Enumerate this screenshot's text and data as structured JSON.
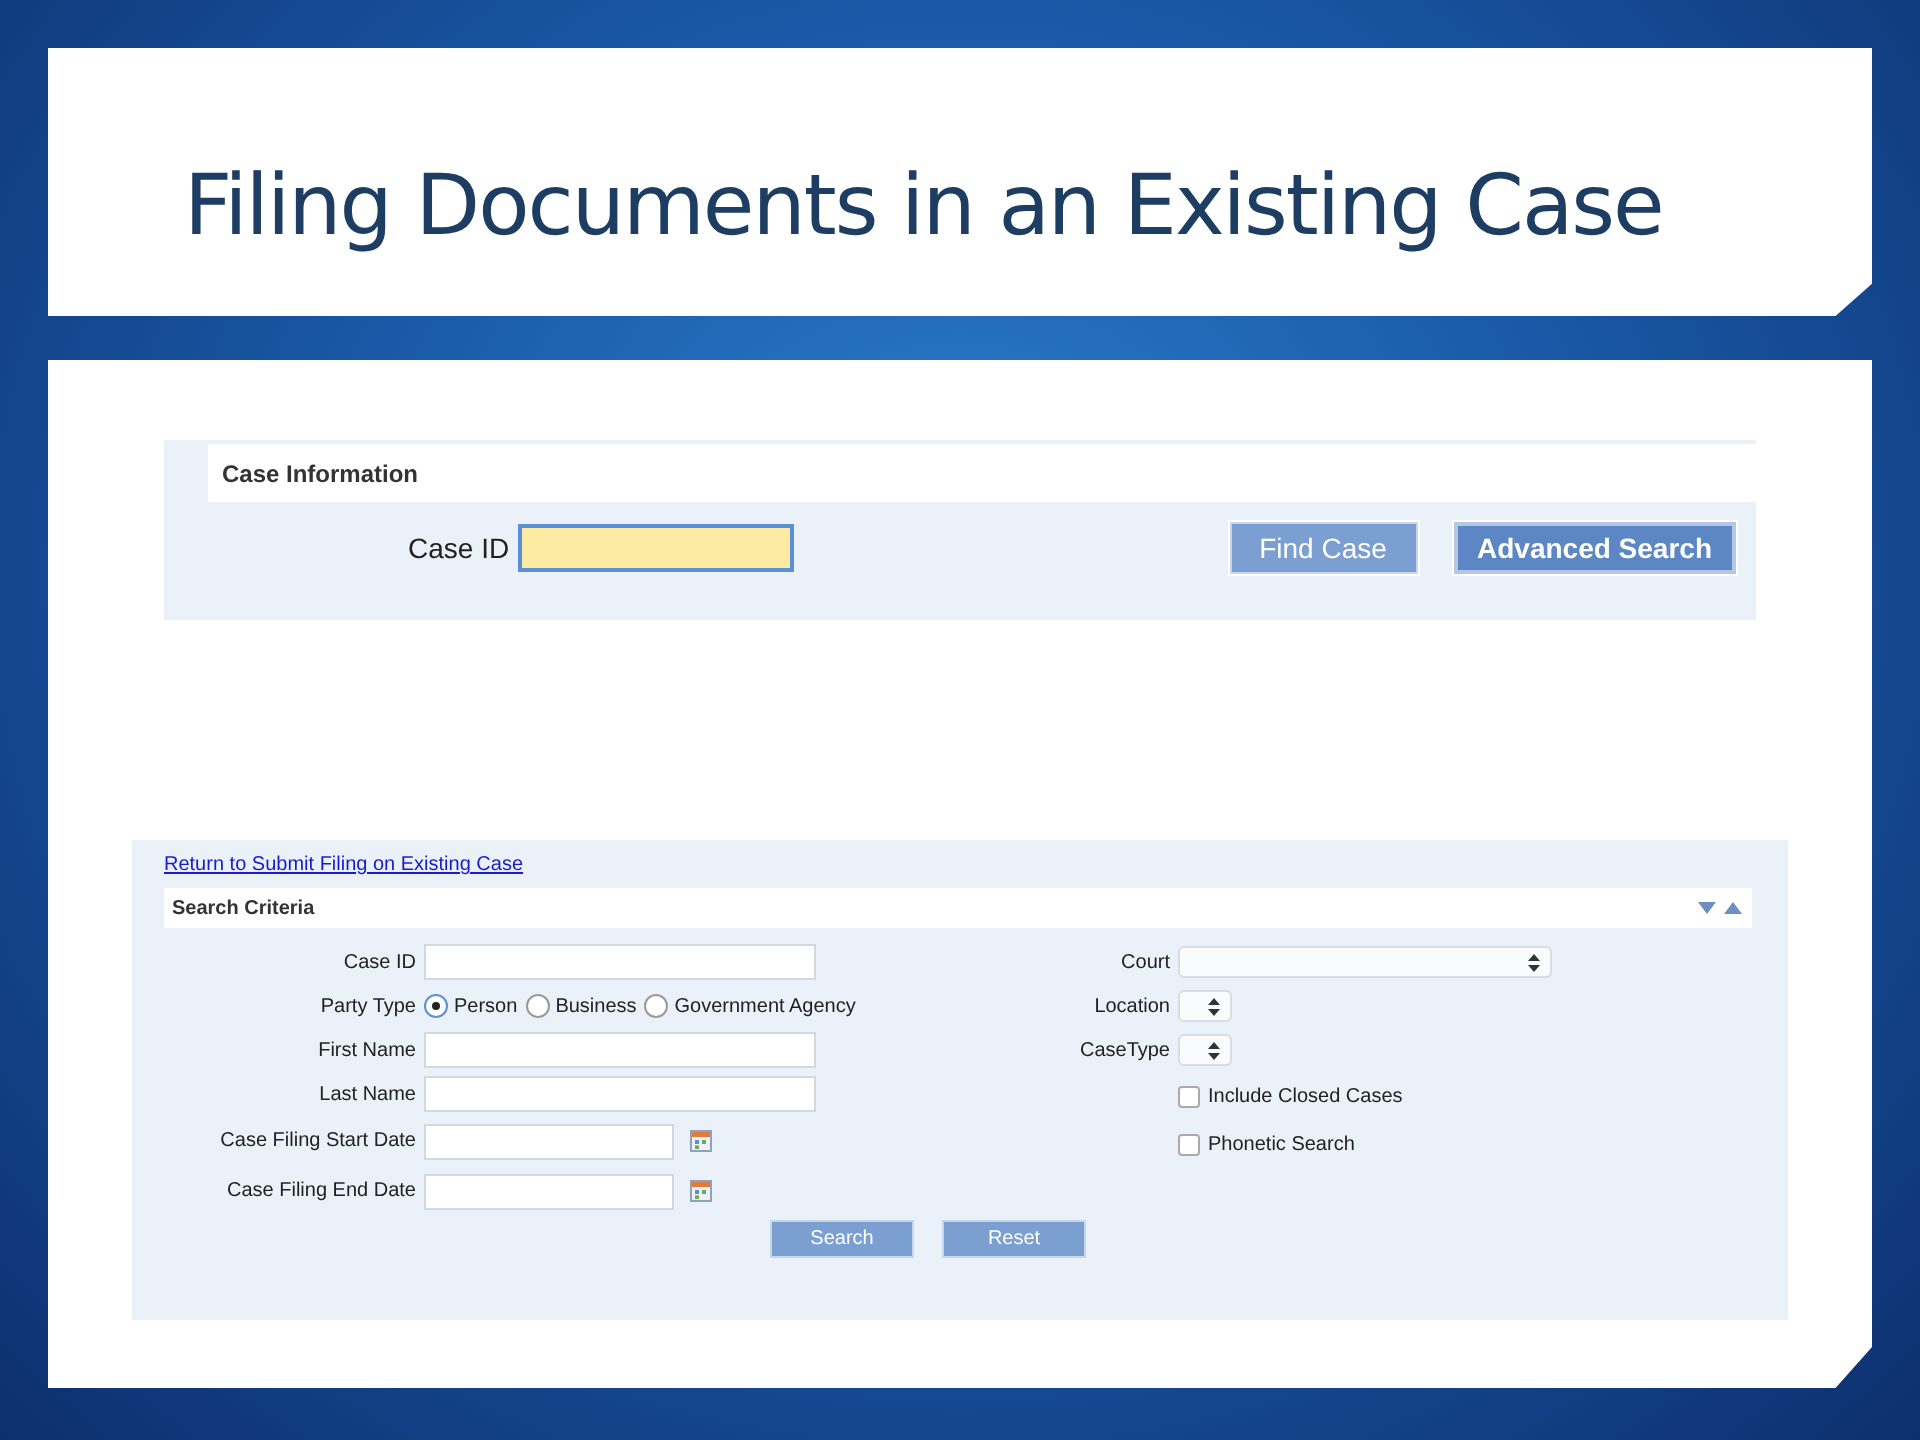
{
  "slide_title": "Filing Documents in an Existing Case",
  "case_information": {
    "heading": "Case Information",
    "field": {
      "label": "Case ID",
      "focused": true
    },
    "buttons": [
      {
        "label": "Find Case",
        "kind": "plain"
      },
      {
        "label": "Advanced Search",
        "kind": "primary"
      }
    ]
  },
  "search_page": {
    "link": "Return to Submit Filing on Existing Case",
    "heading": "Search Criteria",
    "left_fields": [
      {
        "kind": "text",
        "label": "Case ID"
      },
      {
        "kind": "radio",
        "label": "Party Type",
        "options": [
          {
            "label": "Person",
            "selected": true
          },
          {
            "label": "Business",
            "selected": false
          },
          {
            "label": "Government Agency",
            "selected": false
          }
        ]
      },
      {
        "kind": "text",
        "label": "First Name"
      },
      {
        "kind": "text",
        "label": "Last Name"
      },
      {
        "kind": "date",
        "label": "Case Filing Start Date"
      },
      {
        "kind": "date",
        "label": "Case Filing End Date"
      }
    ],
    "right_fields": [
      {
        "kind": "select",
        "label": "Court"
      },
      {
        "kind": "select",
        "label": "Location"
      },
      {
        "kind": "select",
        "label": "CaseType"
      },
      {
        "kind": "checkbox",
        "label": "Include Closed Cases",
        "checked": false
      },
      {
        "kind": "checkbox",
        "label": "Phonetic Search",
        "checked": false
      }
    ],
    "buttons": [
      "Search",
      "Reset"
    ]
  }
}
